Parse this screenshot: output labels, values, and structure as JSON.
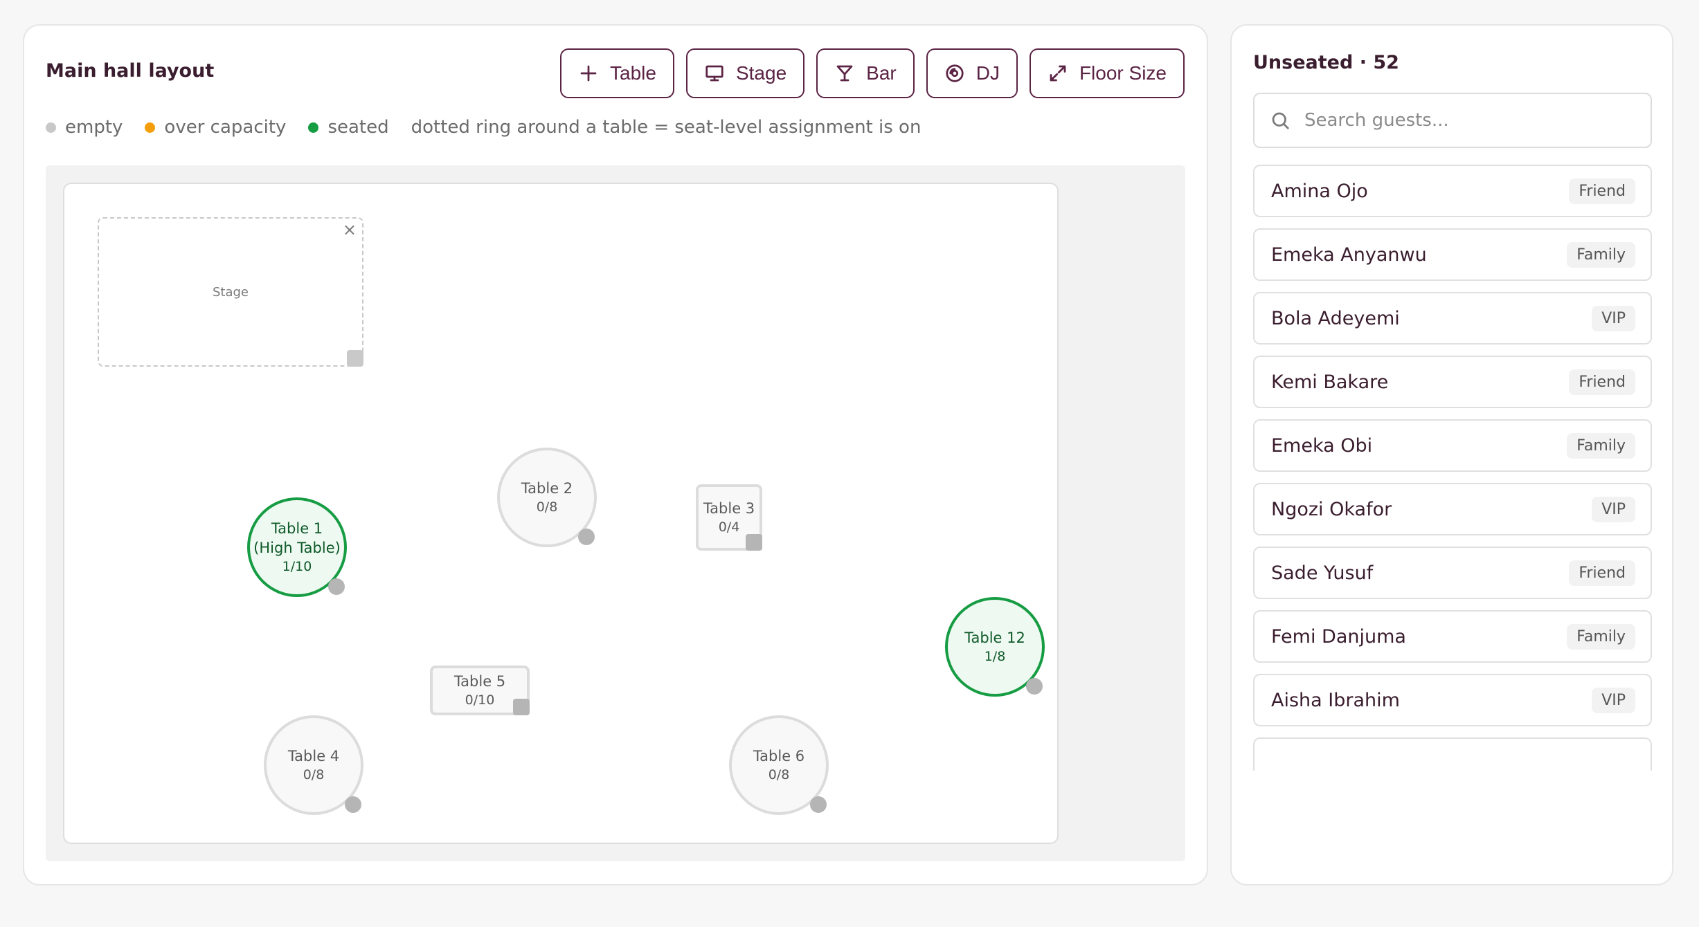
{
  "layout": {
    "title": "Main hall layout",
    "toolbar": {
      "table_label": "Table",
      "stage_label": "Stage",
      "bar_label": "Bar",
      "dj_label": "DJ",
      "floor_size_label": "Floor Size"
    },
    "legend": {
      "empty": "empty",
      "over_capacity": "over capacity",
      "seated": "seated",
      "note": "dotted ring around a table = seat-level assignment is on"
    },
    "legend_colors": {
      "empty": "#c8c8c8",
      "over_capacity": "#f59e0b",
      "seated": "#169c43"
    },
    "stage": {
      "label": "Stage",
      "close": "×"
    },
    "tables": {
      "t1": {
        "name": "Table 1",
        "sub": "(High Table)",
        "count": "1/10"
      },
      "t2": {
        "name": "Table 2",
        "count": "0/8"
      },
      "t3": {
        "name": "Table 3",
        "count": "0/4"
      },
      "t4": {
        "name": "Table 4",
        "count": "0/8"
      },
      "t5": {
        "name": "Table 5",
        "count": "0/10"
      },
      "t6": {
        "name": "Table 6",
        "count": "0/8"
      },
      "t12": {
        "name": "Table 12",
        "count": "1/8"
      }
    }
  },
  "guests": {
    "title": "Unseated · 52",
    "search_placeholder": "Search guests...",
    "items": [
      {
        "name": "Amina Ojo",
        "tag": "Friend"
      },
      {
        "name": "Emeka Anyanwu",
        "tag": "Family"
      },
      {
        "name": "Bola Adeyemi",
        "tag": "VIP"
      },
      {
        "name": "Kemi Bakare",
        "tag": "Friend"
      },
      {
        "name": "Emeka Obi",
        "tag": "Family"
      },
      {
        "name": "Ngozi Okafor",
        "tag": "VIP"
      },
      {
        "name": "Sade Yusuf",
        "tag": "Friend"
      },
      {
        "name": "Femi Danjuma",
        "tag": "Family"
      },
      {
        "name": "Aisha Ibrahim",
        "tag": "VIP"
      }
    ]
  }
}
